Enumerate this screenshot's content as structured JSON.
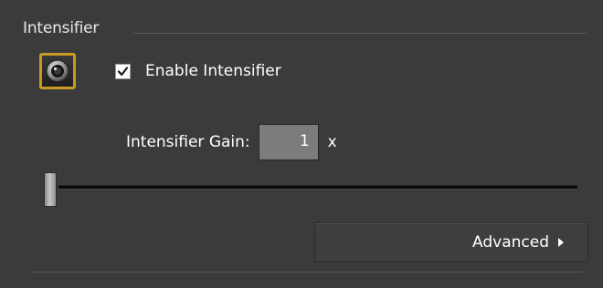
{
  "group": {
    "title": "Intensifier"
  },
  "camera_button": {
    "icon": "camera-lens-icon",
    "accent": "#c89a22"
  },
  "enable": {
    "label": "Enable Intensifier",
    "checked": true
  },
  "gain": {
    "label": "Intensifier Gain:",
    "value": "1",
    "unit": "x"
  },
  "slider": {
    "level": 0
  },
  "advanced": {
    "label": "Advanced",
    "icon": "chevron-right-icon"
  },
  "colors": {
    "background": "#3b3b3b",
    "accent": "#c89a22",
    "input_bg": "#7c7c7c"
  }
}
